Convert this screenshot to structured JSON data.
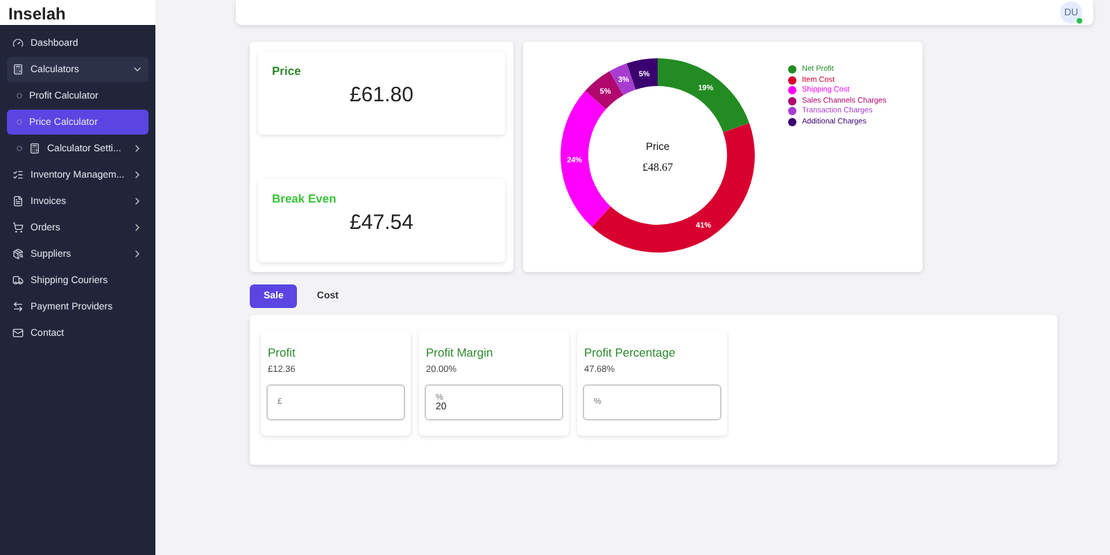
{
  "brand": "Inselah",
  "sidebar": {
    "items": [
      {
        "label": "Dashboard",
        "selected": false
      },
      {
        "label": "Calculators",
        "selected": false,
        "expanded": true,
        "children": [
          {
            "label": "Profit Calculator",
            "selected": false
          },
          {
            "label": "Price Calculator",
            "selected": true
          },
          {
            "label": "Calculator Setti...",
            "selected": false,
            "expanded": false
          }
        ]
      },
      {
        "label": "Inventory Managem...",
        "selected": false,
        "expanded": false
      },
      {
        "label": "Invoices",
        "selected": false,
        "expanded": false
      },
      {
        "label": "Orders",
        "selected": false,
        "expanded": false
      },
      {
        "label": "Suppliers",
        "selected": false,
        "expanded": false
      },
      {
        "label": "Shipping Couriers",
        "selected": false
      },
      {
        "label": "Payment Providers",
        "selected": false
      },
      {
        "label": "Contact",
        "selected": false
      }
    ]
  },
  "header": {
    "avatar": "DU",
    "online": true
  },
  "summary": [
    {
      "label": "Price",
      "value": "£61.80",
      "color": "#2e8b2e"
    },
    {
      "label": "Break Even",
      "value": "£47.54",
      "color": "#3cc43c"
    }
  ],
  "chart": {
    "center_label": "Price",
    "center_value": "£48.67",
    "legend": [
      {
        "color": "#228b22"
      },
      {
        "color": "#d7002f"
      },
      {
        "color": "#ff00ff"
      },
      {
        "color": "#b0086d"
      },
      {
        "color": "#a83cd0"
      },
      {
        "color": "#3a0070"
      }
    ],
    "chart_data": {
      "type": "donut",
      "categories": [
        "Net Profit",
        "Item Cost",
        "Shipping Cost",
        "Sales Channels Charges",
        "Transaction Charges",
        "Additional Charges"
      ],
      "values": [
        19,
        41,
        24,
        5,
        3,
        5
      ],
      "data_labels": true,
      "value_labels": [
        "19%",
        "41%",
        "24%",
        "5%",
        "3%",
        "5%"
      ]
    }
  },
  "tabs": [
    {
      "label": "Sale",
      "selected": true
    },
    {
      "label": "Cost",
      "selected": false
    }
  ],
  "metrics": [
    {
      "title": "Profit",
      "value": "£12.36",
      "field_label": "£"
    },
    {
      "title": "Profit Margin",
      "value": "20.00%",
      "field_label": "%",
      "field_value": "20"
    },
    {
      "title": "Profit Percentage",
      "value": "47.68%",
      "field_label": "%"
    }
  ]
}
